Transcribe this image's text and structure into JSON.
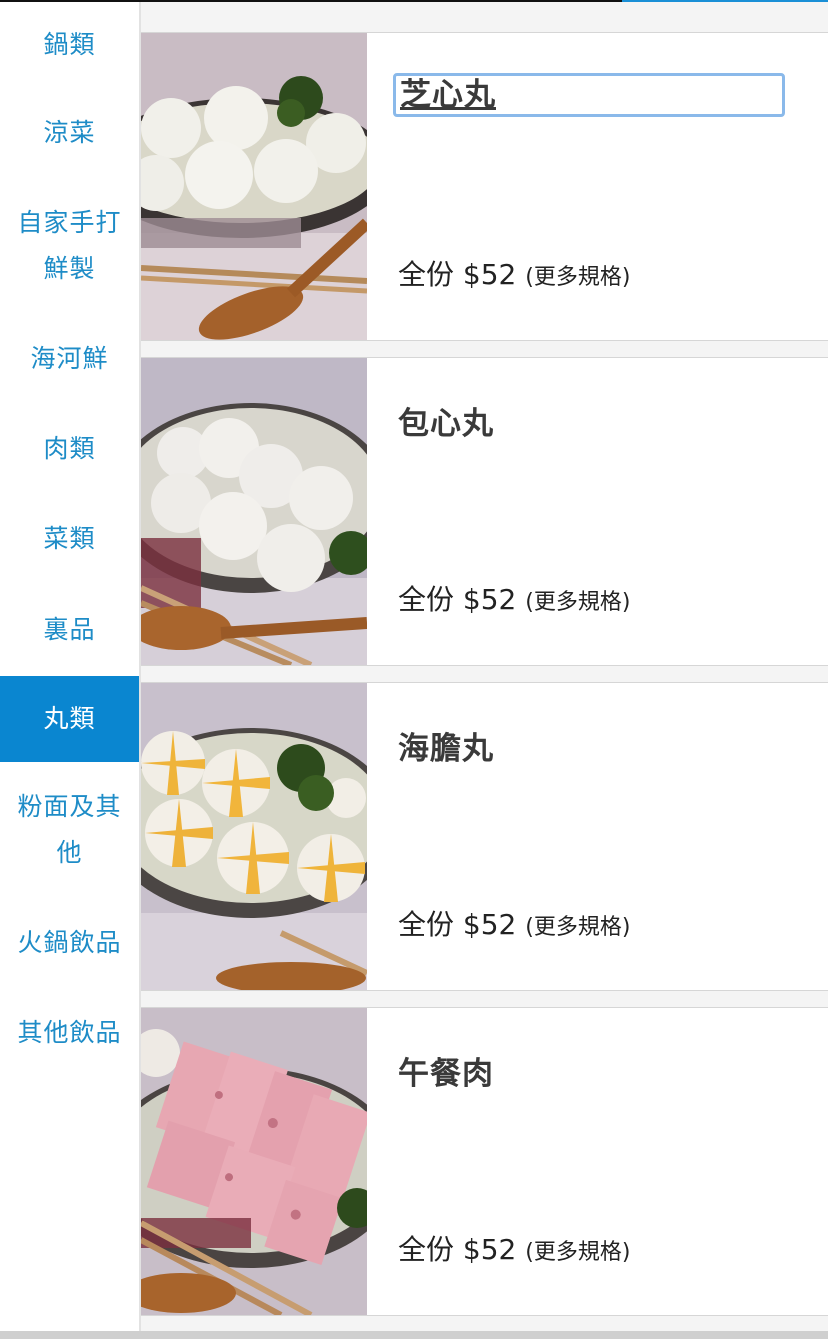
{
  "sidebar": {
    "categories": [
      {
        "label": "鍋類"
      },
      {
        "label": "涼菜"
      },
      {
        "label": "自家手打鮮製"
      },
      {
        "label": "海河鮮"
      },
      {
        "label": "肉類"
      },
      {
        "label": "菜類"
      },
      {
        "label": "裏品"
      },
      {
        "label": "丸類"
      },
      {
        "label": "粉面及其他"
      },
      {
        "label": "火鍋飲品"
      },
      {
        "label": "其他飲品"
      }
    ],
    "active": "丸類"
  },
  "products": [
    {
      "name": "芝心丸",
      "portion": "全份",
      "price": "$52",
      "more": "(更多規格)",
      "image": "white-balls-plate"
    },
    {
      "name": "包心丸",
      "portion": "全份",
      "price": "$52",
      "more": "(更多規格)",
      "image": "white-dumpling-balls-plate"
    },
    {
      "name": "海膽丸",
      "portion": "全份",
      "price": "$52",
      "more": "(更多規格)",
      "image": "yellow-striped-balls-plate"
    },
    {
      "name": "午餐肉",
      "portion": "全份",
      "price": "$52",
      "more": "(更多規格)",
      "image": "luncheon-meat-slices-plate"
    }
  ],
  "colors": {
    "accent": "#0a86d0",
    "category_text": "#1e8cc7",
    "focus_ring": "#8ab9ea"
  }
}
